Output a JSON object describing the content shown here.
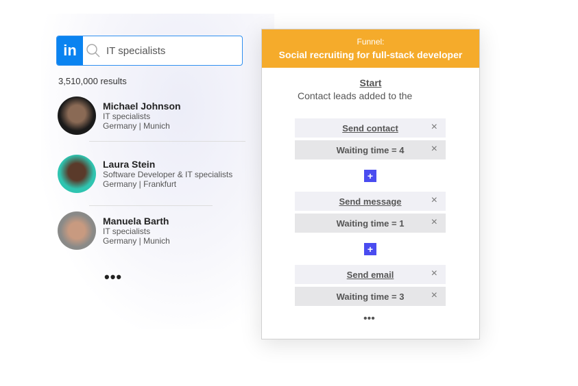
{
  "search": {
    "logo": "in",
    "query": "IT specialists",
    "icon": "search-icon"
  },
  "results_count": "3,510,000 results",
  "people": [
    {
      "name": "Michael Johnson",
      "title": "IT specialists",
      "location": "Germany | Munich"
    },
    {
      "name": "Laura Stein",
      "title": "Software Developer &  IT specialists",
      "location": "Germany | Frankfurt"
    },
    {
      "name": "Manuela Barth",
      "title": "IT specialists",
      "location": "Germany | Munich"
    }
  ],
  "more": "•••",
  "funnel": {
    "label": "Funnel:",
    "title": "Social recruiting for full-stack developer",
    "start": "Start",
    "description": "Contact leads added to the",
    "steps": [
      {
        "label": "Send contact"
      },
      {
        "label": "Waiting time = 4"
      },
      {
        "label": "Send message"
      },
      {
        "label": "Waiting time = 1"
      },
      {
        "label": "Send email"
      },
      {
        "label": "Waiting time = 3"
      }
    ],
    "plus": "+",
    "close": "×",
    "more": "•••"
  },
  "colors": {
    "accent": "#f5ab2b",
    "linkedin": "#0a83f0",
    "plus": "#4a4cf0"
  }
}
